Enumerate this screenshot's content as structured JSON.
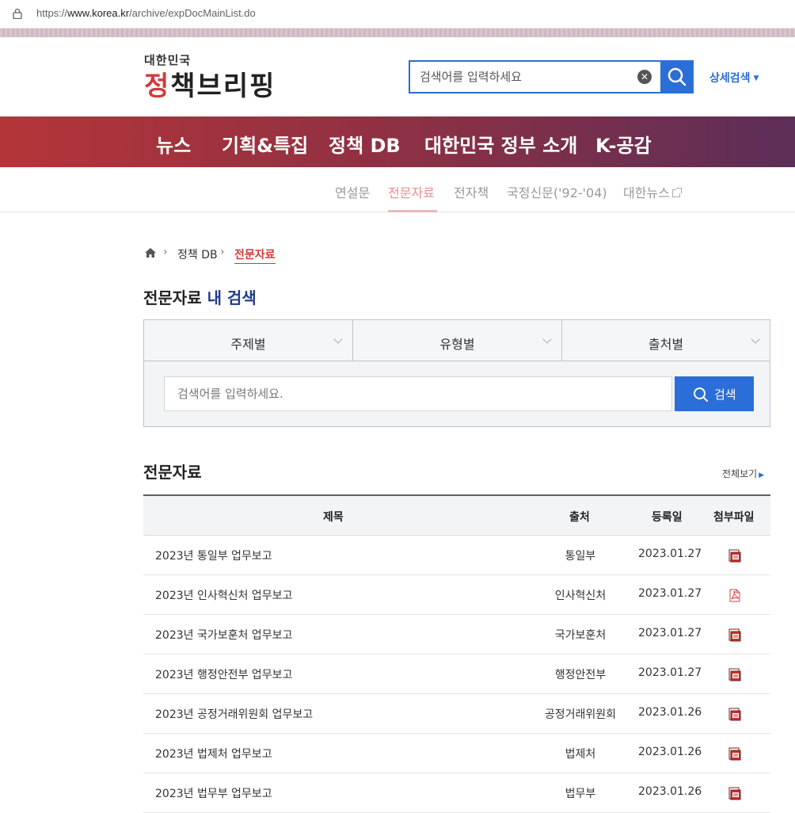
{
  "browser": {
    "url_prefix": "https://",
    "url_domain": "www.korea.kr",
    "url_path": "/archive/expDocMainList.do"
  },
  "header": {
    "logo_small": "대한민국",
    "logo_big_red": "정",
    "logo_big_rest": "책브리핑",
    "search_placeholder": "검색어를 입력하세요",
    "advanced_search": "상세검색"
  },
  "gnb": [
    "뉴스",
    "기획&특집",
    "정책 DB",
    "대한민국 정부 소개",
    "K-공감"
  ],
  "subnav": [
    "연설문",
    "전문자료",
    "전자책",
    "국정신문('92-'04)",
    "대한뉴스"
  ],
  "breadcrumb": [
    "정책 DB",
    "전문자료"
  ],
  "search_section": {
    "title_part1": "전문자료",
    "title_part2": " 내 검색",
    "filters": [
      "주제별",
      "유형별",
      "출처별"
    ],
    "input_placeholder": "검색어를 입력하세요.",
    "button_label": "검색"
  },
  "list_section": {
    "title": "전문자료",
    "more_label": "전체보기",
    "columns": [
      "제목",
      "출처",
      "등록일",
      "첨부파일"
    ],
    "rows": [
      {
        "title": "2023년 통일부 업무보고",
        "source": "통일부",
        "date": "2023.01.27",
        "file": "hwp"
      },
      {
        "title": "2023년 인사혁신처 업무보고",
        "source": "인사혁신처",
        "date": "2023.01.27",
        "file": "pdf"
      },
      {
        "title": "2023년 국가보훈처 업무보고",
        "source": "국가보훈처",
        "date": "2023.01.27",
        "file": "hwp"
      },
      {
        "title": "2023년 행정안전부 업무보고",
        "source": "행정안전부",
        "date": "2023.01.27",
        "file": "hwp"
      },
      {
        "title": "2023년 공정거래위원회 업무보고",
        "source": "공정거래위원회",
        "date": "2023.01.26",
        "file": "hwp"
      },
      {
        "title": "2023년 법제처 업무보고",
        "source": "법제처",
        "date": "2023.01.26",
        "file": "hwp"
      },
      {
        "title": "2023년 법무부 업무보고",
        "source": "법무부",
        "date": "2023.01.26",
        "file": "hwp"
      }
    ]
  },
  "colors": {
    "accent_blue": "#2b6ed8",
    "brand_red": "#d23a3a",
    "gnb_start": "#b43539",
    "gnb_end": "#5c2e58"
  }
}
